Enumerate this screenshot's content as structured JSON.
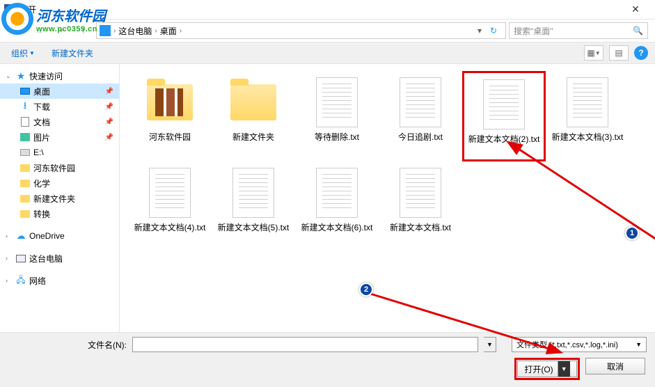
{
  "title": "打开",
  "overlay_logo": {
    "name": "河东软件园",
    "url": "www.pc0359.cn"
  },
  "breadcrumb": {
    "item1": "这台电脑",
    "item2": "桌面"
  },
  "search": {
    "placeholder": "搜索\"桌面\""
  },
  "toolbar": {
    "organize": "组织",
    "new_folder": "新建文件夹"
  },
  "sidebar": {
    "quick": "快速访问",
    "desktop": "桌面",
    "downloads": "下载",
    "documents": "文档",
    "pictures": "图片",
    "drive_e": "E:\\",
    "folder1": "河东软件园",
    "folder2": "化学",
    "folder3": "新建文件夹",
    "folder4": "转换",
    "onedrive": "OneDrive",
    "this_pc": "这台电脑",
    "network": "网络"
  },
  "files": [
    {
      "label": "河东软件园",
      "type": "folder-art"
    },
    {
      "label": "新建文件夹",
      "type": "folder"
    },
    {
      "label": "等待删除.txt",
      "type": "txt"
    },
    {
      "label": "今日追剧.txt",
      "type": "txt"
    },
    {
      "label": "新建文本文档(2).txt",
      "type": "txt",
      "highlight": true
    },
    {
      "label": "新建文本文档(3).txt",
      "type": "txt"
    },
    {
      "label": "新建文本文档(4).txt",
      "type": "txt"
    },
    {
      "label": "新建文本文档(5).txt",
      "type": "txt"
    },
    {
      "label": "新建文本文档(6).txt",
      "type": "txt"
    },
    {
      "label": "新建文本文档.txt",
      "type": "txt"
    }
  ],
  "bottom": {
    "filename_label": "文件名(N):",
    "filetype_label": "文件类型 (*.txt,*.csv,*.log,*.ini)",
    "open": "打开(O)",
    "cancel": "取消"
  },
  "annotations": {
    "n1": "1",
    "n2": "2"
  }
}
